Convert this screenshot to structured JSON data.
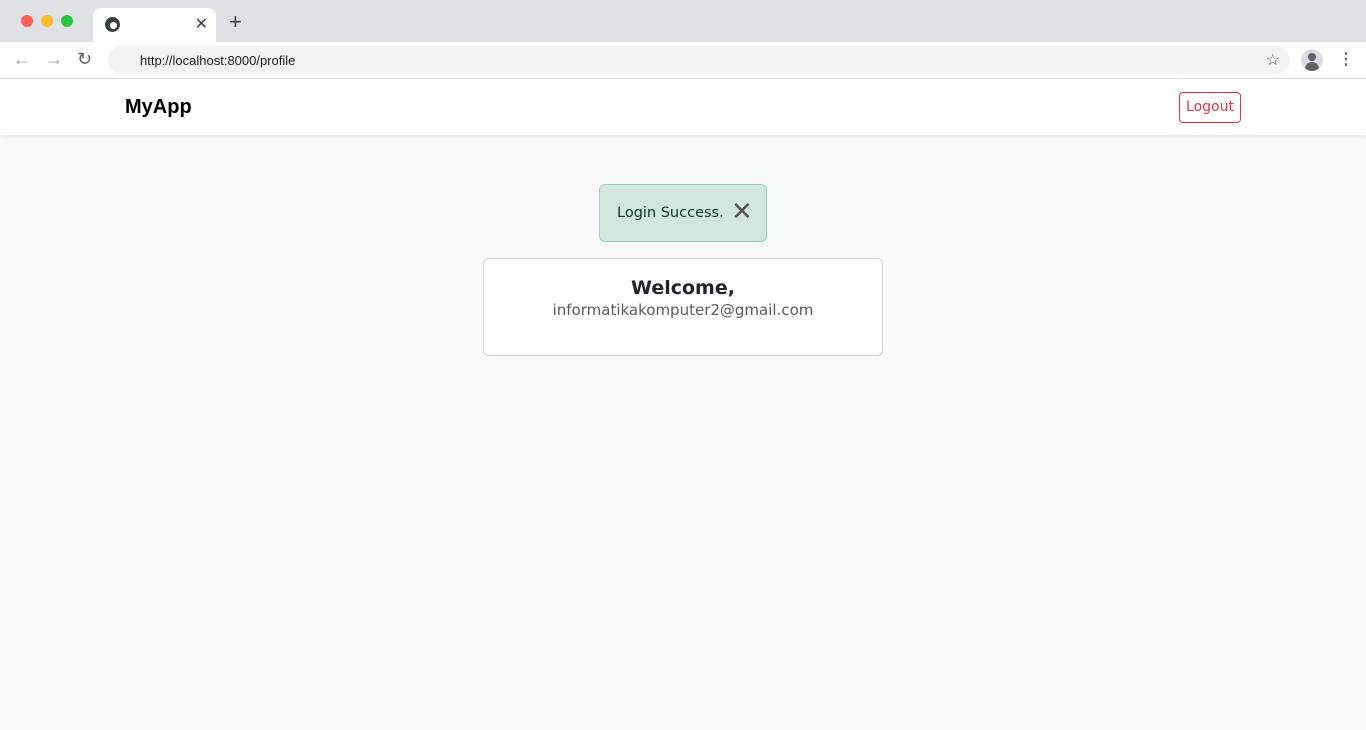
{
  "browser": {
    "tab_close": "✕",
    "new_tab": "+",
    "url": "http://localhost:8000/profile",
    "back": "←",
    "forward": "→",
    "reload": "↻",
    "star": "☆",
    "menu": "⋮"
  },
  "navbar": {
    "brand": "MyApp",
    "logout_label": "Logout"
  },
  "alert": {
    "message": "Login Success.",
    "close": "✕"
  },
  "card": {
    "title": "Welcome,",
    "email": "informatikakomputer2@gmail.com"
  },
  "colors": {
    "danger": "#dc3545",
    "success_bg": "#d1e7dd"
  }
}
